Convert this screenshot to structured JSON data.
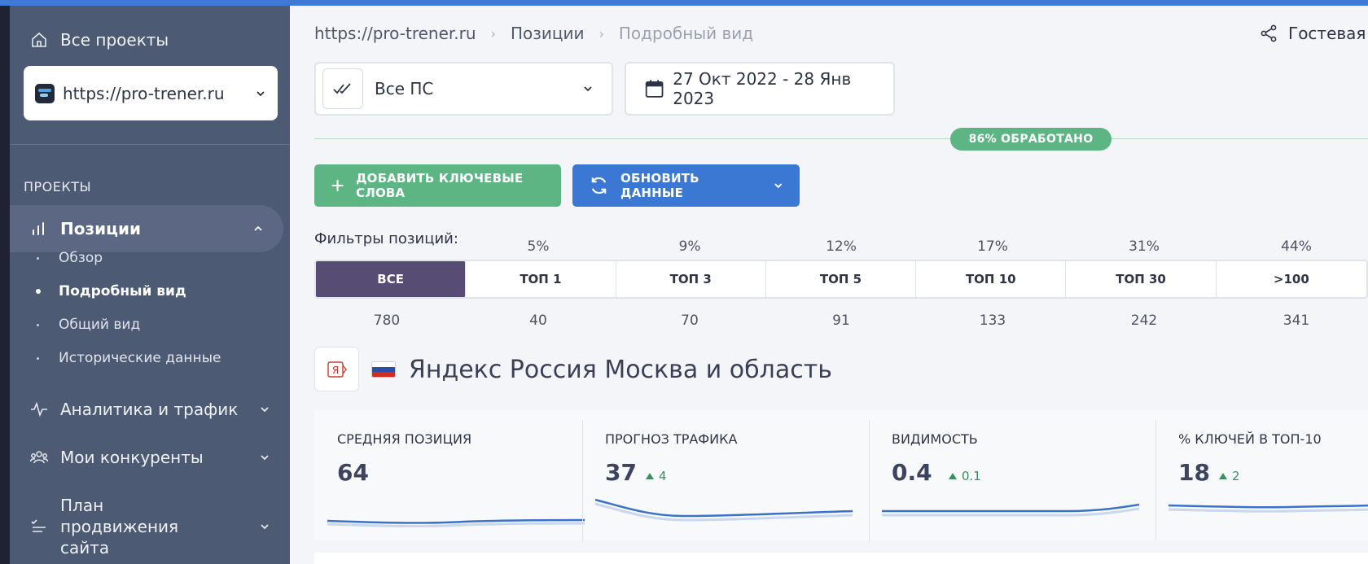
{
  "sidebar": {
    "all_projects": "Все проекты",
    "project_select": "https://pro-trener.ru",
    "section_title": "ПРОЕКТЫ",
    "active_item": "Позиции",
    "subitems": [
      "Обзор",
      "Подробный вид",
      "Общий вид",
      "Исторические данные"
    ],
    "items": [
      "Аналитика и трафик",
      "Мои конкуренты",
      "План продвижения сайта"
    ]
  },
  "breadcrumb": [
    "https://pro-trener.ru",
    "Позиции",
    "Подробный вид"
  ],
  "guest_label": "Гостевая с",
  "search_engine_select": "Все ПС",
  "date_range": "27 Окт 2022 - 28 Янв 2023",
  "progress_badge": "86% ОБРАБОТАНО",
  "progress_value": 0.86,
  "buttons": {
    "add_keywords": "ДОБАВИТЬ КЛЮЧЕВЫЕ СЛОВА",
    "update_data": "ОБНОВИТЬ ДАННЫЕ"
  },
  "filters": {
    "title": "Фильтры позиций:",
    "tabs": [
      {
        "label": "ВСЕ",
        "percent": "",
        "count": "780"
      },
      {
        "label": "ТОП 1",
        "percent": "5%",
        "count": "40"
      },
      {
        "label": "ТОП 3",
        "percent": "9%",
        "count": "70"
      },
      {
        "label": "ТОП 5",
        "percent": "12%",
        "count": "91"
      },
      {
        "label": "ТОП 10",
        "percent": "17%",
        "count": "133"
      },
      {
        "label": "ТОП 30",
        "percent": "31%",
        "count": "242"
      },
      {
        "label": ">100",
        "percent": "44%",
        "count": "341"
      }
    ]
  },
  "region": {
    "engine_icon": "yandex-icon",
    "title": "Яндекс Россия Москва и область"
  },
  "metrics": [
    {
      "label": "СРЕДНЯЯ ПОЗИЦИЯ",
      "value": "64",
      "delta": ""
    },
    {
      "label": "ПРОГНОЗ ТРАФИКА",
      "value": "37",
      "delta": "4"
    },
    {
      "label": "ВИДИМОСТЬ",
      "value": "0.4",
      "delta": "0.1"
    },
    {
      "label": "% КЛЮЧЕЙ В ТОП-10",
      "value": "18",
      "delta": "2"
    }
  ],
  "colors": {
    "accent_blue": "#3a78d4",
    "accent_green": "#5cb582",
    "active_tab": "#574c74",
    "sidebar_bg": "#4d5a74"
  }
}
